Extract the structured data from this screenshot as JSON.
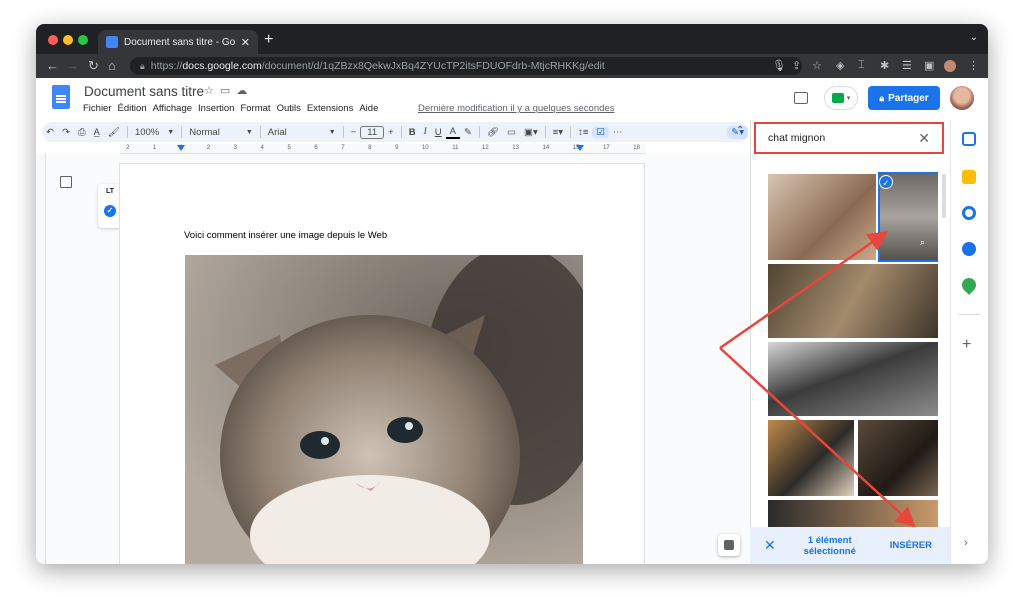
{
  "browser": {
    "tab_title": "Document sans titre - Google Docs",
    "url_host": "docs.google.com",
    "url_prefix": "https://",
    "url_path": "/document/d/1qZBzx8QekwJxBq4ZYUcTP2itsFDUOFdrb-MtjcRHKKg/edit"
  },
  "docs": {
    "title": "Document sans titre",
    "menu": [
      "Fichier",
      "Édition",
      "Affichage",
      "Insertion",
      "Format",
      "Outils",
      "Extensions",
      "Aide"
    ],
    "last_modified": "Dernière modification il y a quelques secondes",
    "share_label": "Partager",
    "toolbar": {
      "zoom": "100%",
      "style": "Normal",
      "font": "Arial",
      "font_size": "11"
    },
    "ruler_ticks": [
      "2",
      "1",
      "1",
      "2",
      "3",
      "4",
      "5",
      "6",
      "7",
      "8",
      "9",
      "10",
      "11",
      "12",
      "13",
      "14",
      "15",
      "17",
      "18"
    ],
    "lt_label": "LT",
    "body_text": "Voici comment insérer une image depuis le Web"
  },
  "image_search": {
    "query": "chat mignon",
    "selected_count": "1 élément sélectionné",
    "insert_label": "INSÉRER"
  },
  "colors": {
    "accent": "#1a73e8",
    "highlight_red": "#e8453c"
  },
  "icons": [
    "undo-icon",
    "redo-icon",
    "print-icon",
    "spellcheck-icon",
    "paint-format-icon",
    "bold-icon",
    "italic-icon",
    "underline-icon",
    "text-color-icon",
    "highlight-icon",
    "link-icon",
    "comment-icon",
    "image-icon",
    "align-icon",
    "line-spacing-icon",
    "checklist-icon",
    "more-icon",
    "pencil-icon",
    "star-icon",
    "folder-icon",
    "cloud-icon",
    "lock-icon",
    "close-icon",
    "calendar-icon",
    "keep-icon",
    "tasks-icon",
    "contacts-icon",
    "maps-icon",
    "plus-icon"
  ]
}
